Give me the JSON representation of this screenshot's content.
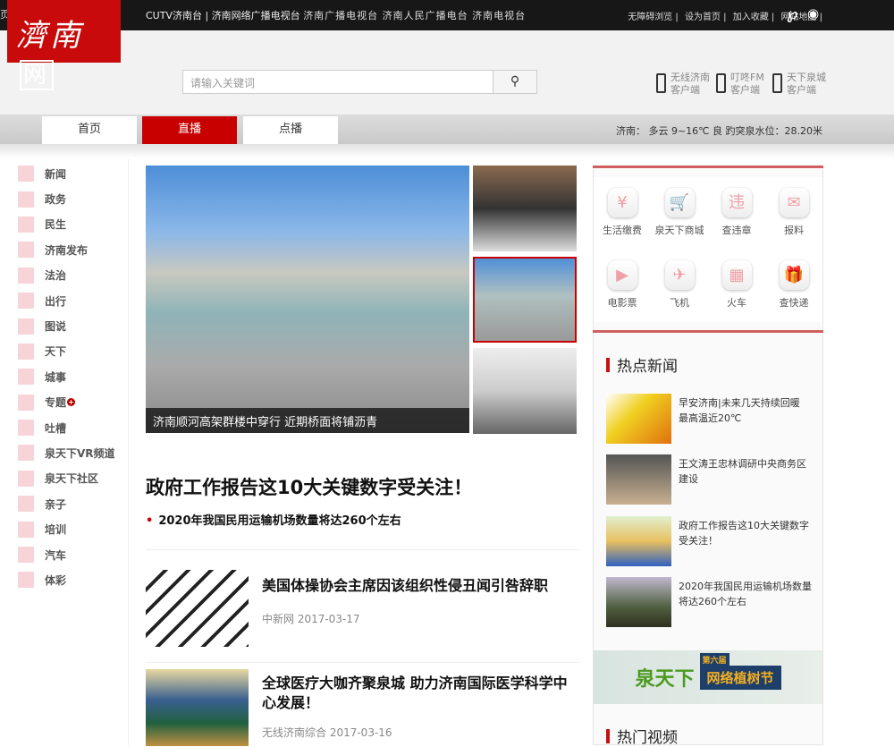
{
  "topbar": {
    "edge_char": "页",
    "site_links": [
      "CUTV济南台",
      "济南网络广播电视台"
    ],
    "stations": "济南广播电视台 济南人民广播电台 济南电视台",
    "right_links": [
      "无障碍浏览",
      "设为首页",
      "加入收藏",
      "网站地图"
    ]
  },
  "logo": {
    "text": "濟南",
    "suffix": "网"
  },
  "search": {
    "placeholder": "请输入关键词"
  },
  "apps": [
    {
      "name": "无线济南",
      "sub": "客户端"
    },
    {
      "name": "叮咚FM",
      "sub": "客户端"
    },
    {
      "name": "天下泉城",
      "sub": "客户端"
    }
  ],
  "nav": {
    "tabs": [
      "首页",
      "直播",
      "点播"
    ],
    "weather": "济南： 多云 9~16℃ 良 趵突泉水位：28.20米"
  },
  "sidebar": [
    "新闻",
    "政务",
    "民生",
    "济南发布",
    "法治",
    "出行",
    "图说",
    "天下",
    "城事",
    "专题",
    "吐槽",
    "泉天下VR频道",
    "泉天下社区",
    "亲子",
    "培训",
    "汽车",
    "体彩"
  ],
  "slider": {
    "caption": "济南顺河高架群楼中穿行 近期桥面将铺沥青"
  },
  "headline": {
    "title": "政府工作报告这10大关键数字受关注！",
    "sub": "2020年我国民用运输机场数量将达260个左右"
  },
  "articles": [
    {
      "title": "美国体操协会主席因该组织性侵丑闻引咎辞职",
      "source": "中新网 2017-03-17"
    },
    {
      "title": "全球医疗大咖齐聚泉城 助力济南国际医学科学中心发展！",
      "source": "无线济南综合 2017-03-16"
    }
  ],
  "services": [
    {
      "label": "生活缴费",
      "icon": "¥"
    },
    {
      "label": "泉天下商城",
      "icon": "🛒"
    },
    {
      "label": "查违章",
      "icon": "违"
    },
    {
      "label": "报料",
      "icon": "✉"
    },
    {
      "label": "电影票",
      "icon": "▶"
    },
    {
      "label": "飞机",
      "icon": "✈"
    },
    {
      "label": "火车",
      "icon": "▦"
    },
    {
      "label": "查快递",
      "icon": "🎁"
    }
  ],
  "hot_news": {
    "title": "热点新闻",
    "items": [
      "早安济南|未来几天持续回暖 最高温近20℃",
      "王文涛王忠林调研中央商务区建设",
      "政府工作报告这10大关键数字受关注！",
      "2020年我国民用运输机场数量将达260个左右"
    ]
  },
  "banner": {
    "brand": "泉天下",
    "edition": "第六届",
    "title": "网络植树节"
  },
  "hot_video": {
    "title": "热门视频"
  }
}
